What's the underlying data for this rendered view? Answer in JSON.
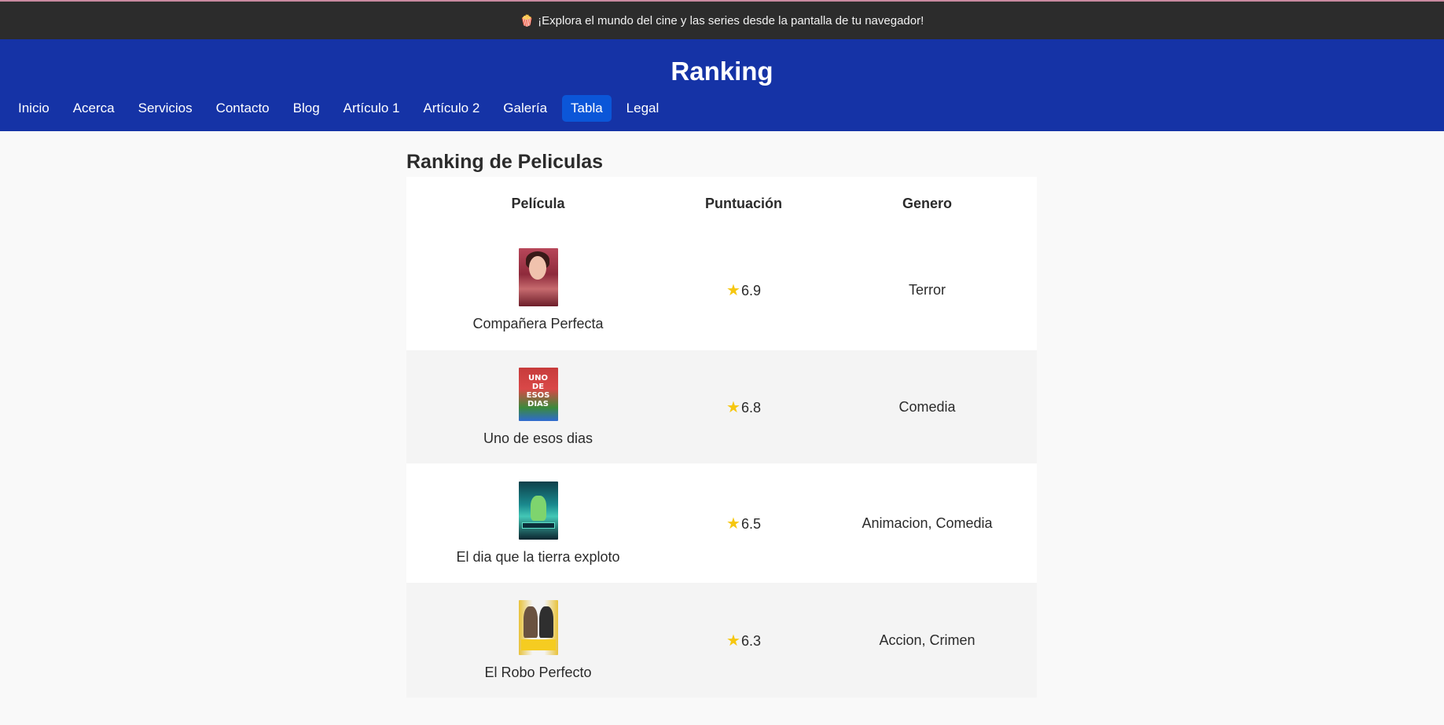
{
  "banner": {
    "icon": "popcorn-icon",
    "text": "¡Explora el mundo del cine y las series desde la pantalla de tu navegador!"
  },
  "header": {
    "title": "Ranking"
  },
  "nav": {
    "items": [
      {
        "label": "Inicio"
      },
      {
        "label": "Acerca"
      },
      {
        "label": "Servicios"
      },
      {
        "label": "Contacto"
      },
      {
        "label": "Blog"
      },
      {
        "label": "Artículo 1"
      },
      {
        "label": "Artículo 2"
      },
      {
        "label": "Galería"
      },
      {
        "label": "Tabla",
        "active": true
      },
      {
        "label": "Legal"
      }
    ]
  },
  "main": {
    "heading": "Ranking de Peliculas",
    "table": {
      "headers": [
        "Película",
        "Puntuación",
        "Genero"
      ],
      "rows": [
        {
          "title": "Compañera Perfecta",
          "score": "6.9",
          "genre": "Terror"
        },
        {
          "title": "Uno de esos dias",
          "score": "6.8",
          "genre": "Comedia",
          "poster_text": "UNO DE ESOS DIAS"
        },
        {
          "title": "El dia que la tierra exploto",
          "score": "6.5",
          "genre": "Animacion, Comedia"
        },
        {
          "title": "El Robo Perfecto",
          "score": "6.3",
          "genre": "Accion, Crimen"
        }
      ]
    }
  },
  "colors": {
    "header_bg": "#1533a6",
    "topbar_bg": "#2c2c2c",
    "nav_active_bg": "#0b56d8",
    "star": "#f6c710"
  },
  "icons": {
    "star": "star-icon",
    "popcorn": "popcorn-icon"
  }
}
